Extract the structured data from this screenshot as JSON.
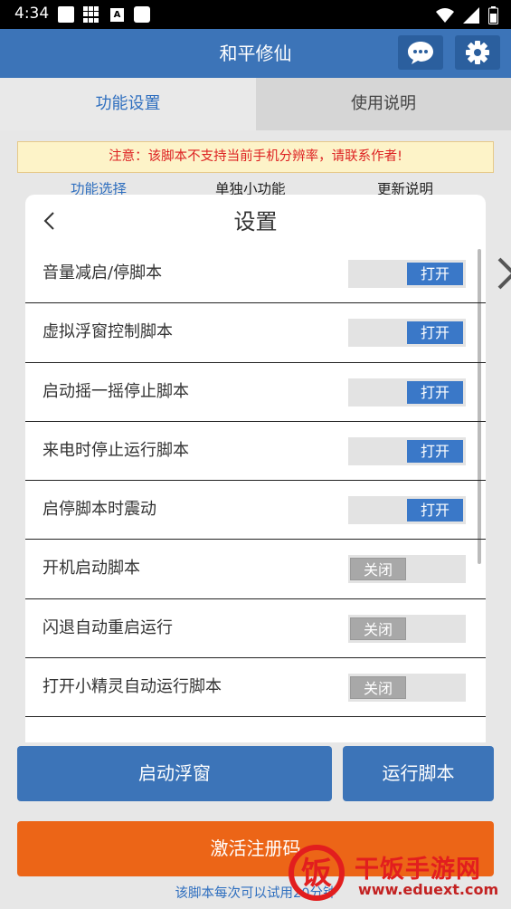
{
  "status_bar": {
    "time": "4:34",
    "a_icon_letter": "A"
  },
  "app_bar": {
    "title": "和平修仙",
    "icons": [
      "chat-icon",
      "gear-icon"
    ]
  },
  "tabs": [
    {
      "label": "功能设置",
      "active": true
    },
    {
      "label": "使用说明",
      "active": false
    }
  ],
  "warning": "注意：该脚本不支持当前手机分辨率，请联系作者!",
  "subtabs": [
    {
      "label": "功能选择",
      "active": true
    },
    {
      "label": "单独小功能",
      "active": false
    },
    {
      "label": "更新说明",
      "active": false
    }
  ],
  "settings_panel": {
    "title": "设置",
    "rows": [
      {
        "label": "音量减启/停脚本",
        "state": "打开",
        "on": true
      },
      {
        "label": "虚拟浮窗控制脚本",
        "state": "打开",
        "on": true
      },
      {
        "label": "启动摇一摇停止脚本",
        "state": "打开",
        "on": true
      },
      {
        "label": "来电时停止运行脚本",
        "state": "打开",
        "on": true
      },
      {
        "label": "启停脚本时震动",
        "state": "打开",
        "on": true
      },
      {
        "label": "开机启动脚本",
        "state": "关闭",
        "on": false
      },
      {
        "label": "闪退自动重启运行",
        "state": "关闭",
        "on": false
      },
      {
        "label": "打开小精灵自动运行脚本",
        "state": "关闭",
        "on": false
      }
    ]
  },
  "buttons": {
    "float_window": "启动浮窗",
    "run_script": "运行脚本",
    "activate": "激活注册码"
  },
  "footer_note": "该脚本每次可以试用20分钟",
  "watermark": {
    "brand": "干饭手游网",
    "url": "www.eduext.com",
    "logo_char": "饭"
  },
  "colors": {
    "primary": "#3c74b8",
    "accent_orange": "#ec6517",
    "warning_text": "#dd2222",
    "toggle_on": "#3a78c8",
    "toggle_off": "#a8a8a8"
  }
}
